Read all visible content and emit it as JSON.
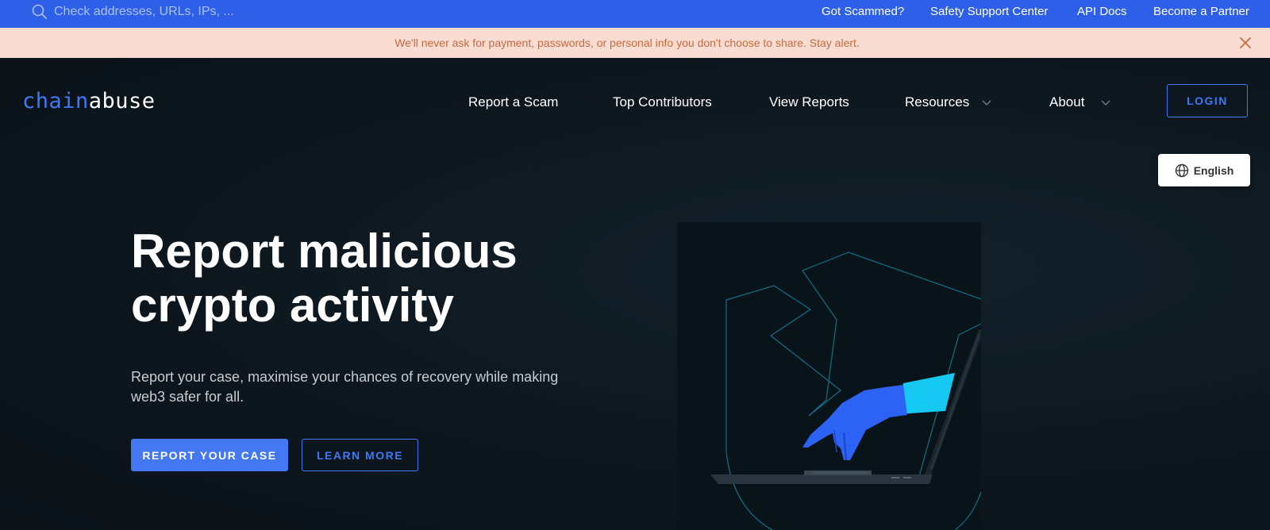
{
  "search": {
    "placeholder": "Check addresses, URLs, IPs, ..."
  },
  "top_links": [
    "Got Scammed?",
    "Safety Support Center",
    "API Docs",
    "Become a Partner"
  ],
  "alert": {
    "text": "We'll never ask for payment, passwords, or personal info you don't choose to share. Stay alert."
  },
  "logo": {
    "chain": "chain",
    "abuse": "abuse"
  },
  "nav": {
    "items": [
      {
        "label": "Report a Scam"
      },
      {
        "label": "Top Contributors"
      },
      {
        "label": "View Reports"
      },
      {
        "label": "Resources"
      },
      {
        "label": "About"
      }
    ],
    "login": "LOGIN"
  },
  "language": "English",
  "hero": {
    "title": "Report malicious crypto activity",
    "subtitle": "Report your case, maximise your chances of recovery while making web3 safer for all.",
    "primary_button": "REPORT YOUR CASE",
    "secondary_button": "LEARN MORE"
  },
  "colors": {
    "topbar": "#2e5fe8",
    "alert_bg": "#f9dcd2",
    "alert_text": "#c96a3e",
    "accent": "#3e79f5",
    "background": "#0c151c"
  }
}
